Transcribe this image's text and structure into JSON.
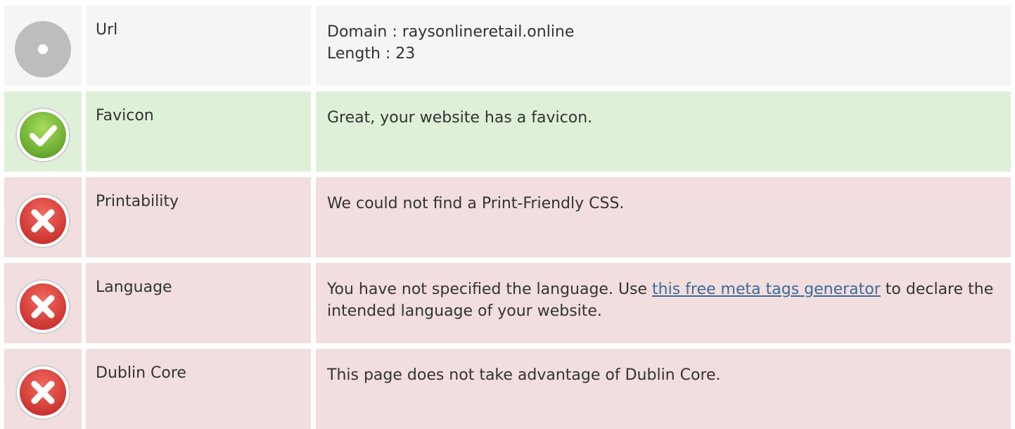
{
  "rows": [
    {
      "status": "neutral",
      "icon": "neutral-dot-icon",
      "label": "Url",
      "lines": [
        "Domain : raysonlineretail.online",
        "Length : 23"
      ]
    },
    {
      "status": "pass",
      "icon": "check-icon",
      "label": "Favicon",
      "text": "Great, your website has a favicon."
    },
    {
      "status": "fail",
      "icon": "error-x-icon",
      "label": "Printability",
      "text": "We could not find a Print-Friendly CSS."
    },
    {
      "status": "fail",
      "icon": "error-x-icon",
      "label": "Language",
      "text_before": "You have not specified the language. Use ",
      "link_text": "this free meta tags generator",
      "text_after": " to declare the intended language of your website."
    },
    {
      "status": "fail",
      "icon": "error-x-icon",
      "label": "Dublin Core",
      "text": "This page does not take advantage of Dublin Core."
    }
  ],
  "colors": {
    "neutral_bg": "#f5f5f5",
    "pass_bg": "#dff0d8",
    "fail_bg": "#f2dede",
    "link": "#3b6a99",
    "check_green": "#7cc242",
    "error_red": "#e0413f"
  }
}
